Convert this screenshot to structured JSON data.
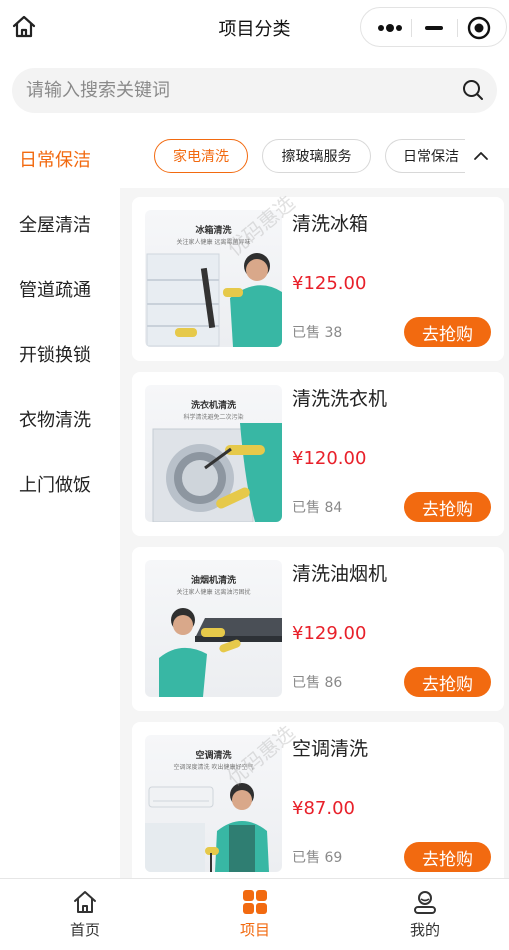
{
  "header": {
    "title": "项目分类"
  },
  "search": {
    "placeholder": "请输入搜索关键词",
    "value": ""
  },
  "sidebar": {
    "items": [
      {
        "label": "日常保洁",
        "active": true
      },
      {
        "label": "全屋清洁",
        "active": false
      },
      {
        "label": "管道疏通",
        "active": false
      },
      {
        "label": "开锁换锁",
        "active": false
      },
      {
        "label": "衣物清洗",
        "active": false
      },
      {
        "label": "上门做饭",
        "active": false
      }
    ]
  },
  "subtabs": {
    "items": [
      {
        "label": "家电清洗",
        "active": true
      },
      {
        "label": "擦玻璃服务",
        "active": false
      },
      {
        "label": "日常保洁",
        "active": false
      }
    ]
  },
  "products": [
    {
      "name": "清洗冰箱",
      "price": "¥125.00",
      "sold": "已售 38",
      "button": "去抢购",
      "thumb_title": "冰箱清洗",
      "thumb_sub": "关注家人健康 远离霉菌异味"
    },
    {
      "name": "清洗洗衣机",
      "price": "¥120.00",
      "sold": "已售 84",
      "button": "去抢购",
      "thumb_title": "洗衣机清洗",
      "thumb_sub": "科学清洗避免二次污染"
    },
    {
      "name": "清洗油烟机",
      "price": "¥129.00",
      "sold": "已售 86",
      "button": "去抢购",
      "thumb_title": "油烟机清洗",
      "thumb_sub": "关注家人健康 远离油污困扰"
    },
    {
      "name": "空调清洗",
      "price": "¥87.00",
      "sold": "已售 69",
      "button": "去抢购",
      "thumb_title": "空调清洗",
      "thumb_sub": "空调深度清洗 吹出健康好空气"
    }
  ],
  "watermark": "优码惠选",
  "tabbar": {
    "items": [
      {
        "label": "首页",
        "icon": "home-icon",
        "active": false
      },
      {
        "label": "项目",
        "icon": "grid-icon",
        "active": true
      },
      {
        "label": "我的",
        "icon": "user-icon",
        "active": false
      }
    ]
  },
  "colors": {
    "accent": "#f26a10",
    "price": "#e8202a",
    "background": "#f5f5f5"
  }
}
